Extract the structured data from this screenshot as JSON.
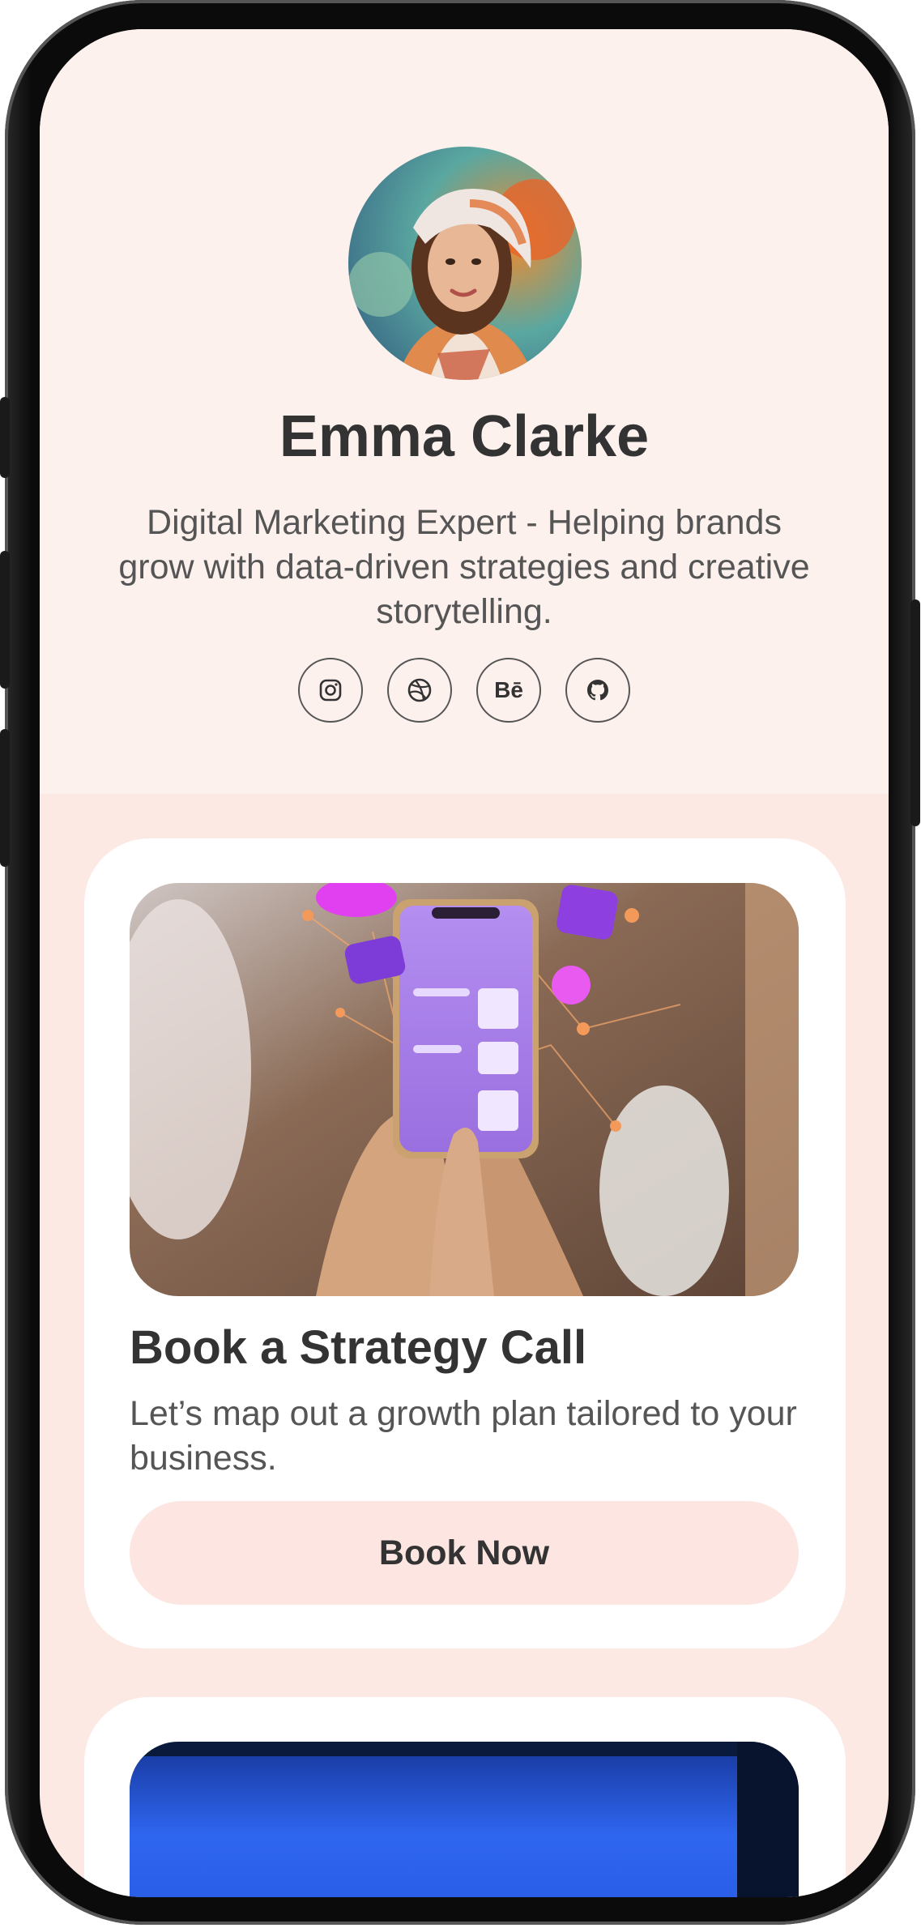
{
  "profile": {
    "name": "Emma Clarke",
    "bio": "Digital Marketing Expert - Helping brands grow with data-driven strategies and creative storytelling."
  },
  "socials": [
    {
      "icon": "instagram-icon"
    },
    {
      "icon": "dribbble-icon"
    },
    {
      "icon": "behance-icon",
      "label": "Bē"
    },
    {
      "icon": "github-icon"
    }
  ],
  "cards": [
    {
      "title": "Book a Strategy Call",
      "description": "Let’s map out a growth plan tailored to your business.",
      "button_label": "Book Now"
    }
  ],
  "colors": {
    "header_bg": "#fdf1ee",
    "page_bg": "#fde9e4",
    "button_bg": "#fde6e1",
    "text_dark": "#333333"
  }
}
